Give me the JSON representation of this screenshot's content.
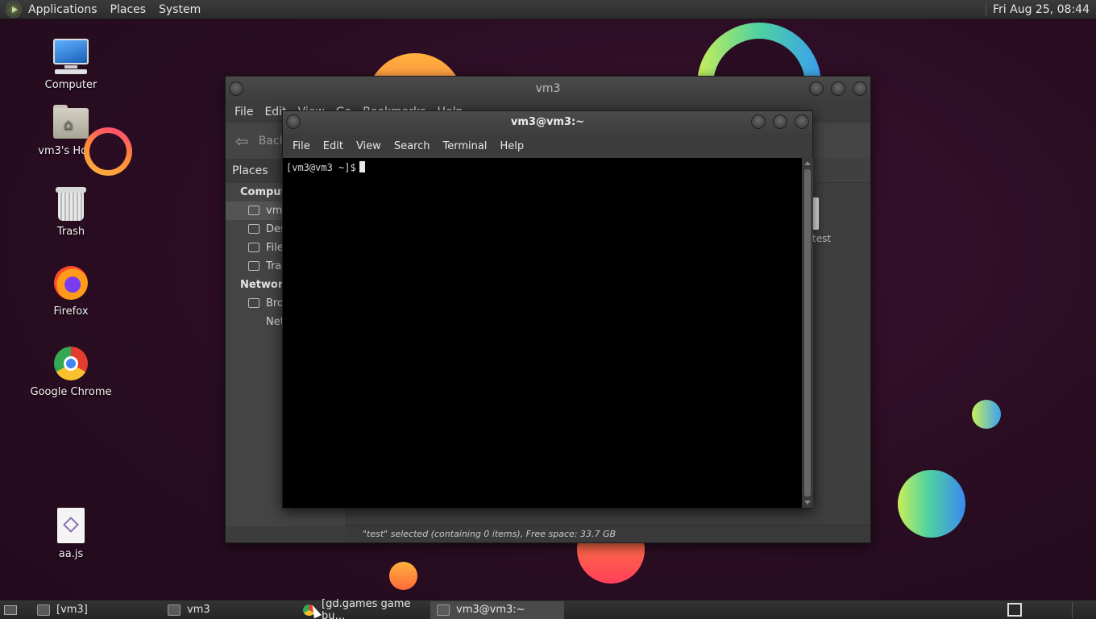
{
  "top_panel": {
    "menus": [
      "Applications",
      "Places",
      "System"
    ],
    "clock": "Fri Aug 25, 08:44"
  },
  "desktop_icons": [
    {
      "label": "Computer",
      "icon": "computer-icon"
    },
    {
      "label": "vm3's Home",
      "icon": "home-folder-icon"
    },
    {
      "label": "Trash",
      "icon": "trash-icon"
    },
    {
      "label": "Firefox",
      "icon": "firefox-icon"
    },
    {
      "label": "Google Chrome",
      "icon": "chrome-icon"
    },
    {
      "label": "aa.js",
      "icon": "script-file-icon"
    }
  ],
  "file_manager": {
    "title": "vm3",
    "menus": [
      "File",
      "Edit",
      "View",
      "Go",
      "Bookmarks",
      "Help"
    ],
    "back_label": "Back",
    "places_header": "Places",
    "sections": {
      "computer": "Computer",
      "network": "Network"
    },
    "places_items": [
      "vm3",
      "Desktop",
      "File System",
      "Trash"
    ],
    "network_items": [
      "Browse Network"
    ],
    "file_label": "test",
    "status": "\"test\" selected (containing 0 items), Free space: 33.7 GB"
  },
  "terminal": {
    "title": "vm3@vm3:~",
    "menus": [
      "File",
      "Edit",
      "View",
      "Search",
      "Terminal",
      "Help"
    ],
    "prompt": "[vm3@vm3 ~]$"
  },
  "taskbar": {
    "tasks": [
      {
        "label": "[vm3]",
        "icon": "folder-icon"
      },
      {
        "label": "vm3",
        "icon": "home-folder-icon"
      },
      {
        "label": "[gd.games game bu…",
        "icon": "chrome-icon"
      },
      {
        "label": "vm3@vm3:~",
        "icon": "terminal-icon"
      }
    ],
    "active_index": 3
  }
}
